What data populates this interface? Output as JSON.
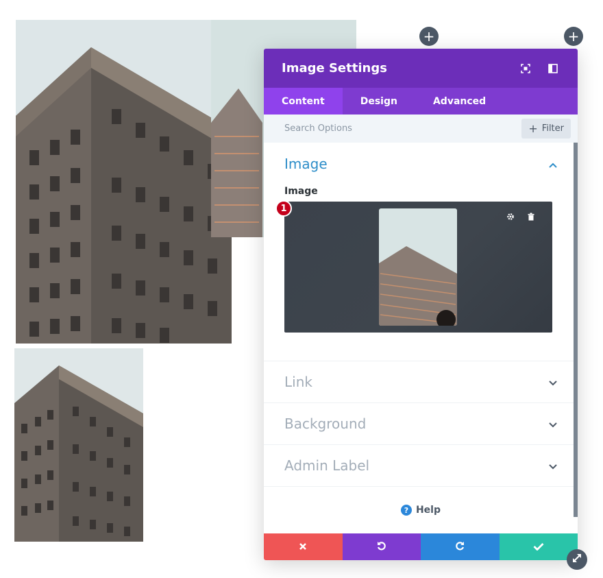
{
  "modal": {
    "title": "Image Settings",
    "tabs": [
      {
        "label": "Content",
        "active": true
      },
      {
        "label": "Design",
        "active": false
      },
      {
        "label": "Advanced",
        "active": false
      }
    ],
    "search_placeholder": "Search Options",
    "filter_label": "Filter",
    "sections": {
      "image": {
        "title": "Image",
        "field_label": "Image",
        "badge": "1"
      },
      "link": {
        "title": "Link"
      },
      "background": {
        "title": "Background"
      },
      "admin_label": {
        "title": "Admin Label"
      }
    },
    "help_label": "Help",
    "help_icon": "?"
  },
  "icons": {
    "add": "+",
    "header": [
      "focus-icon",
      "sidebar-toggle-icon"
    ],
    "footer": [
      "close-icon",
      "undo-icon",
      "redo-icon",
      "check-icon"
    ]
  },
  "colors": {
    "header": "#6c2eb9",
    "tabs": "#7e3bd0",
    "tab_active": "#8f42ec",
    "accent_title": "#2e8ec9",
    "cancel": "#ef5555",
    "undo": "#7e3bd0",
    "redo": "#2b87da",
    "save": "#29c4a9"
  }
}
